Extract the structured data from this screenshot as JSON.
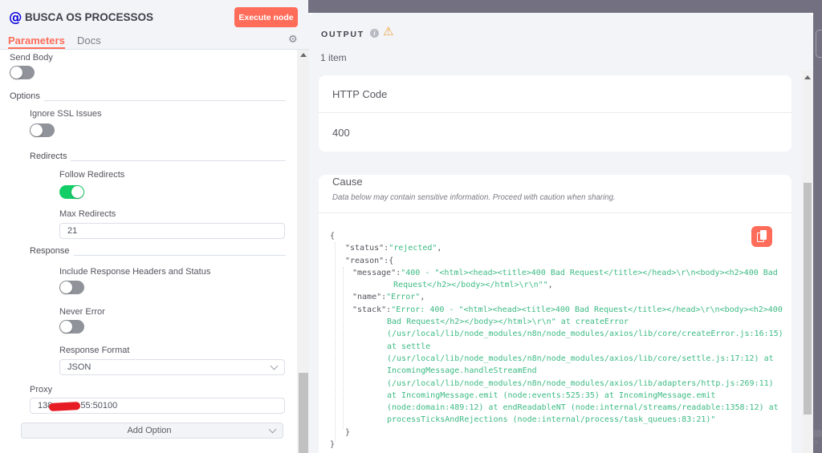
{
  "node": {
    "icon": "@",
    "title": "BUSCA OS PROCESSOS",
    "execute_button": "Execute node",
    "tabs": {
      "parameters": "Parameters",
      "docs": "Docs"
    }
  },
  "parameters": {
    "send_body": {
      "label": "Send Body",
      "value": false
    },
    "options_section": "Options",
    "ignore_ssl": {
      "label": "Ignore SSL Issues",
      "value": false
    },
    "redirects_section": "Redirects",
    "follow_redirects": {
      "label": "Follow Redirects",
      "value": true
    },
    "max_redirects": {
      "label": "Max Redirects",
      "value": "21"
    },
    "response_section": "Response",
    "include_response_headers": {
      "label": "Include Response Headers and Status",
      "value": false
    },
    "never_error": {
      "label": "Never Error",
      "value": false
    },
    "response_format": {
      "label": "Response Format",
      "value": "JSON"
    },
    "proxy": {
      "label": "Proxy",
      "value_prefix": "138",
      "value_suffix": "55:50100",
      "redacted": true
    },
    "add_option": "Add Option"
  },
  "output": {
    "title": "OUTPUT",
    "items_count": "1 item",
    "http_code": {
      "label": "HTTP Code",
      "value": "400"
    },
    "cause": {
      "label": "Cause",
      "warning_note": "Data below may contain sensitive information. Proceed with caution when sharing."
    },
    "json_lines": [
      {
        "x": 0,
        "parts": [
          [
            "p",
            "{"
          ]
        ]
      },
      {
        "x": 19,
        "parts": [
          [
            "k",
            "\"status\""
          ],
          [
            "p",
            ":"
          ],
          [
            "s",
            "\"rejected\""
          ],
          [
            "p",
            ","
          ]
        ]
      },
      {
        "x": 19,
        "parts": [
          [
            "k",
            "\"reason\""
          ],
          [
            "p",
            ":{"
          ]
        ]
      },
      {
        "x": 28,
        "parts": [
          [
            "k",
            "\"message\""
          ],
          [
            "p",
            ":"
          ],
          [
            "s",
            "\"400 - \"<html><head><title>400 Bad Request</title></head>\\r\\n<body><h2>400 Bad"
          ]
        ]
      },
      {
        "x": 79,
        "parts": [
          [
            "s",
            "Request</h2></body></html>\\r\\n\"\""
          ],
          [
            "p",
            ","
          ]
        ]
      },
      {
        "x": 28,
        "parts": [
          [
            "k",
            "\"name\""
          ],
          [
            "p",
            ":"
          ],
          [
            "s",
            "\"Error\""
          ],
          [
            "p",
            ","
          ]
        ]
      },
      {
        "x": 28,
        "parts": [
          [
            "k",
            "\"stack\""
          ],
          [
            "p",
            ":"
          ],
          [
            "s",
            "\"Error: 400 - \"<html><head><title>400 Bad Request</title></head>\\r\\n<body><h2>400"
          ]
        ]
      },
      {
        "x": 71,
        "parts": [
          [
            "s",
            "Bad Request</h2></body></html>\\r\\n\" at createError"
          ]
        ]
      },
      {
        "x": 71,
        "parts": [
          [
            "s",
            "(/usr/local/lib/node_modules/n8n/node_modules/axios/lib/core/createError.js:16:15)"
          ]
        ]
      },
      {
        "x": 71,
        "parts": [
          [
            "s",
            "at settle"
          ]
        ]
      },
      {
        "x": 71,
        "parts": [
          [
            "s",
            "(/usr/local/lib/node_modules/n8n/node_modules/axios/lib/core/settle.js:17:12) at"
          ]
        ]
      },
      {
        "x": 71,
        "parts": [
          [
            "s",
            "IncomingMessage.handleStreamEnd"
          ]
        ]
      },
      {
        "x": 71,
        "parts": [
          [
            "s",
            "(/usr/local/lib/node_modules/n8n/node_modules/axios/lib/adapters/http.js:269:11)"
          ]
        ]
      },
      {
        "x": 71,
        "parts": [
          [
            "s",
            "at IncomingMessage.emit (node:events:525:35) at IncomingMessage.emit"
          ]
        ]
      },
      {
        "x": 71,
        "parts": [
          [
            "s",
            "(node:domain:489:12) at endReadableNT (node:internal/streams/readable:1358:12) at"
          ]
        ]
      },
      {
        "x": 71,
        "parts": [
          [
            "s",
            "processTicksAndRejections (node:internal/process/task_queues:83:21)\""
          ]
        ]
      },
      {
        "x": 19,
        "parts": [
          [
            "p",
            "}"
          ]
        ]
      },
      {
        "x": 0,
        "parts": [
          [
            "p",
            "}"
          ]
        ]
      }
    ]
  },
  "colors": {
    "accent": "#ff6c59",
    "toggle_on": "#13ce66",
    "toggle_off": "#909399",
    "panel_bg": "#f2f4f8",
    "overlay_bg": "#737181",
    "code_string": "#3cba84",
    "node_icon_blue": "#0b00d9"
  }
}
